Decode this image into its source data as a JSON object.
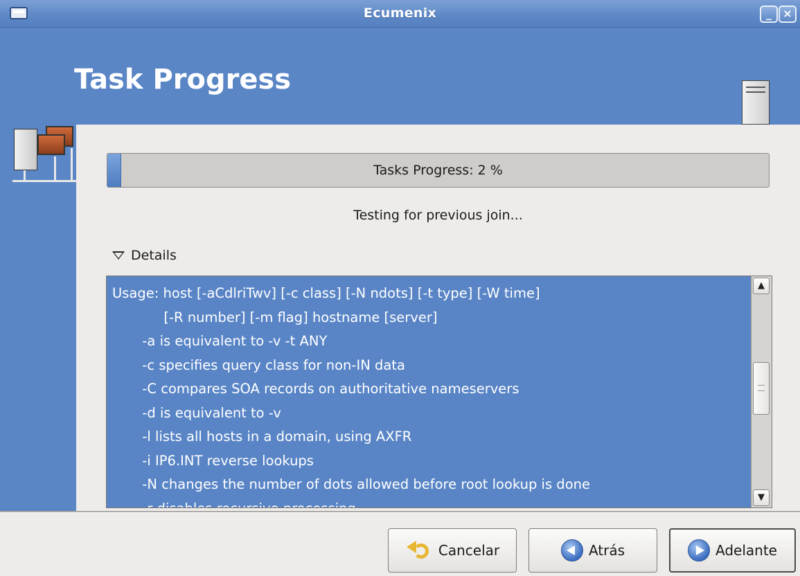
{
  "window": {
    "title": "Ecumenix",
    "minimize_glyph": "_",
    "close_glyph": "×"
  },
  "header": {
    "title": "Task Progress"
  },
  "progress": {
    "label": "Tasks Progress: 2 %",
    "value_percent": 2
  },
  "status": {
    "text": "Testing for previous join..."
  },
  "details": {
    "toggle_label": "Details",
    "expanded": true,
    "log_lines": [
      "Usage: host [-aCdlriTwv] [-c class] [-N ndots] [-t type] [-W time]",
      "            [-R number] [-m flag] hostname [server]",
      "       -a is equivalent to -v -t ANY",
      "       -c specifies query class for non-IN data",
      "       -C compares SOA records on authoritative nameservers",
      "       -d is equivalent to -v",
      "       -l lists all hosts in a domain, using AXFR",
      "       -i IP6.INT reverse lookups",
      "       -N changes the number of dots allowed before root lookup is done",
      "       -r disables recursive processing"
    ]
  },
  "buttons": {
    "cancel": "Cancelar",
    "back": "Atrás",
    "next": "Adelante"
  },
  "icons": {
    "window_menu": "window-menu-icon",
    "server": "server-icon",
    "network": "network-computers-icon",
    "cancel": "undo-arrow-icon",
    "back": "back-arrow-icon",
    "next": "forward-arrow-icon"
  },
  "colors": {
    "accent": "#5b86c6",
    "log_background": "#5985c6",
    "window_background": "#edeceb"
  }
}
